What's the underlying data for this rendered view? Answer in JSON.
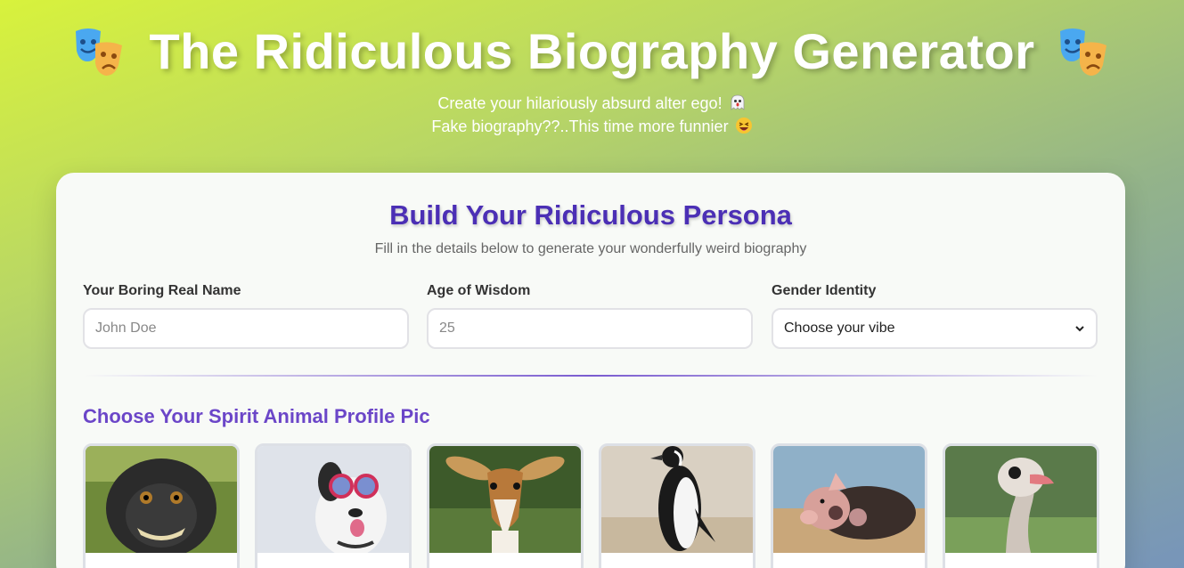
{
  "header": {
    "title": "The Ridiculous Biography Generator",
    "subtitle_line1": "Create your hilariously absurd alter ego!",
    "subtitle_line2": "Fake biography??..This time more funnier",
    "left_icon": "theater-masks-icon",
    "right_icon": "theater-masks-icon"
  },
  "form": {
    "title": "Build Your Ridiculous Persona",
    "description": "Fill in the details below to generate your wonderfully weird biography",
    "name_label": "Your Boring Real Name",
    "name_placeholder": "John Doe",
    "age_label": "Age of Wisdom",
    "age_placeholder": "25",
    "gender_label": "Gender Identity",
    "gender_selected": "Choose your vibe"
  },
  "animals_section": {
    "title": "Choose Your Spirit Animal Profile Pic",
    "animals": [
      "monkey",
      "dog-with-goggles",
      "gazelle",
      "penguin",
      "pig",
      "ostrich"
    ]
  },
  "colors": {
    "title_purple": "#4b2fb5",
    "section_purple": "#6b46c8"
  }
}
